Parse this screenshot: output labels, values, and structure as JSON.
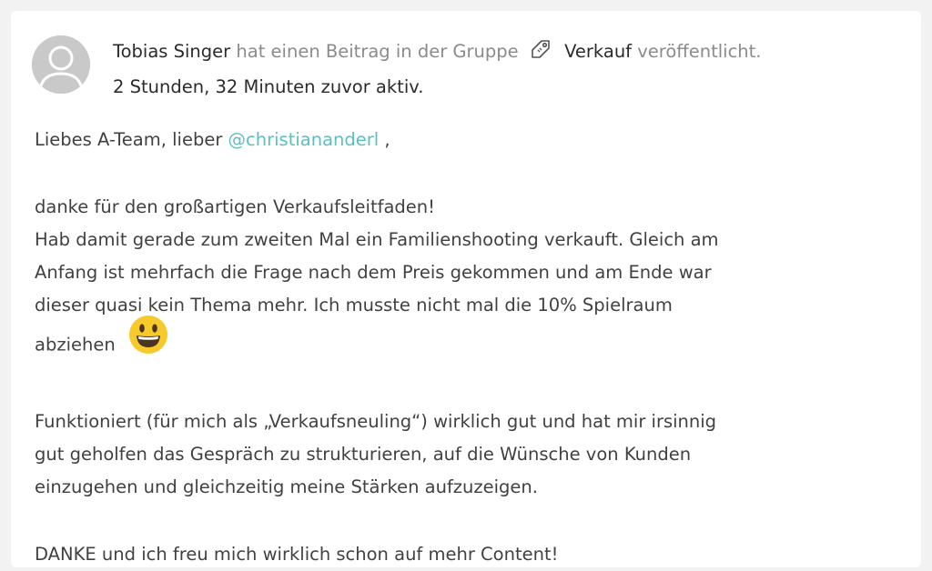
{
  "post": {
    "author": "Tobias Singer",
    "action_before_group": "hat einen Beitrag in der Gruppe",
    "group_name": "Verkauf",
    "action_after_group": "veröffentlicht.",
    "activity": "2 Stunden, 32 Minuten zuvor aktiv.",
    "group_icon": "tag-icon",
    "avatar_icon": "default-avatar-icon"
  },
  "body": {
    "greeting_prefix": "Liebes A-Team, lieber",
    "mention": "@christiananderl",
    "greeting_suffix": " ,",
    "line1": "danke für den großartigen Verkaufsleitfaden!",
    "line2": "Hab damit gerade zum zweiten Mal ein Familienshooting verkauft. Gleich am",
    "line3": "Anfang ist mehrfach die Frage nach dem Preis gekommen und am Ende war",
    "line4": "dieser quasi kein Thema mehr. Ich musste nicht mal die 10% Spielraum",
    "line5": "abziehen",
    "emoji": "grinning-face-emoji",
    "para2_line1": "Funktioniert (für mich als „Verkaufsneuling“) wirklich gut und hat mir irsinnig",
    "para2_line2": "gut geholfen das Gespräch zu strukturieren, auf die Wünsche von Kunden",
    "para2_line3": "einzugehen und gleichzeitig meine Stärken aufzuzeigen.",
    "closing": "DANKE und ich freu mich wirklich schon auf mehr Content!"
  },
  "colors": {
    "mention": "#5bbfc3",
    "text": "#414141",
    "muted": "#8b8b8b",
    "emoji": "#f8c92b"
  }
}
